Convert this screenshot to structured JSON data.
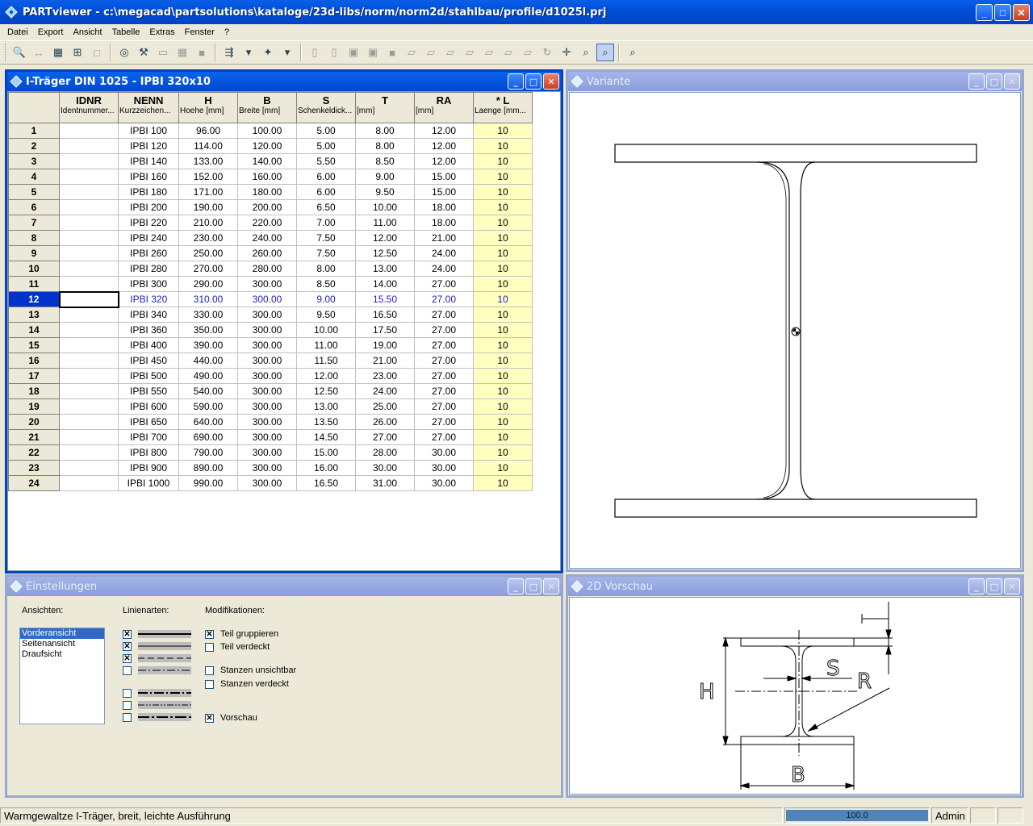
{
  "window": {
    "title": "PARTviewer - c:\\megacad\\partsolutions\\kataloge/23d-libs/norm/norm2d/stahlbau/profile/d1025l.prj",
    "minimize": "_",
    "maximize": "□",
    "close": "✕"
  },
  "menu": [
    "Datei",
    "Export",
    "Ansicht",
    "Tabelle",
    "Extras",
    "Fenster",
    "?"
  ],
  "table_window": {
    "title": "I-Träger DIN 1025 - IPBI 320x10",
    "columns": [
      {
        "name": "IDNR",
        "sub": "Identnummer..."
      },
      {
        "name": "NENN",
        "sub": "Kurzzeichen..."
      },
      {
        "name": "H",
        "sub": "Hoehe [mm]"
      },
      {
        "name": "B",
        "sub": "Breite [mm]"
      },
      {
        "name": "S",
        "sub": "Schenkeldick..."
      },
      {
        "name": "T",
        "sub": "[mm]"
      },
      {
        "name": "RA",
        "sub": "[mm]"
      },
      {
        "name": "* L",
        "sub": "Laenge [mm..."
      }
    ],
    "selected_row": 12,
    "rows": [
      [
        "1",
        "",
        "IPBI 100",
        "96.00",
        "100.00",
        "5.00",
        "8.00",
        "12.00",
        "10"
      ],
      [
        "2",
        "",
        "IPBI 120",
        "114.00",
        "120.00",
        "5.00",
        "8.00",
        "12.00",
        "10"
      ],
      [
        "3",
        "",
        "IPBI 140",
        "133.00",
        "140.00",
        "5.50",
        "8.50",
        "12.00",
        "10"
      ],
      [
        "4",
        "",
        "IPBI 160",
        "152.00",
        "160.00",
        "6.00",
        "9.00",
        "15.00",
        "10"
      ],
      [
        "5",
        "",
        "IPBI 180",
        "171.00",
        "180.00",
        "6.00",
        "9.50",
        "15.00",
        "10"
      ],
      [
        "6",
        "",
        "IPBI 200",
        "190.00",
        "200.00",
        "6.50",
        "10.00",
        "18.00",
        "10"
      ],
      [
        "7",
        "",
        "IPBI 220",
        "210.00",
        "220.00",
        "7.00",
        "11.00",
        "18.00",
        "10"
      ],
      [
        "8",
        "",
        "IPBI 240",
        "230.00",
        "240.00",
        "7.50",
        "12.00",
        "21.00",
        "10"
      ],
      [
        "9",
        "",
        "IPBI 260",
        "250.00",
        "260.00",
        "7.50",
        "12.50",
        "24.00",
        "10"
      ],
      [
        "10",
        "",
        "IPBI 280",
        "270.00",
        "280.00",
        "8.00",
        "13.00",
        "24.00",
        "10"
      ],
      [
        "11",
        "",
        "IPBI 300",
        "290.00",
        "300.00",
        "8.50",
        "14.00",
        "27.00",
        "10"
      ],
      [
        "12",
        "",
        "IPBI 320",
        "310.00",
        "300.00",
        "9.00",
        "15.50",
        "27.00",
        "10"
      ],
      [
        "13",
        "",
        "IPBI 340",
        "330.00",
        "300.00",
        "9.50",
        "16.50",
        "27.00",
        "10"
      ],
      [
        "14",
        "",
        "IPBI 360",
        "350.00",
        "300.00",
        "10.00",
        "17.50",
        "27.00",
        "10"
      ],
      [
        "15",
        "",
        "IPBI 400",
        "390.00",
        "300.00",
        "11.00",
        "19.00",
        "27.00",
        "10"
      ],
      [
        "16",
        "",
        "IPBI 450",
        "440.00",
        "300.00",
        "11.50",
        "21.00",
        "27.00",
        "10"
      ],
      [
        "17",
        "",
        "IPBI 500",
        "490.00",
        "300.00",
        "12.00",
        "23.00",
        "27.00",
        "10"
      ],
      [
        "18",
        "",
        "IPBI 550",
        "540.00",
        "300.00",
        "12.50",
        "24.00",
        "27.00",
        "10"
      ],
      [
        "19",
        "",
        "IPBI 600",
        "590.00",
        "300.00",
        "13.00",
        "25.00",
        "27.00",
        "10"
      ],
      [
        "20",
        "",
        "IPBI 650",
        "640.00",
        "300.00",
        "13.50",
        "26.00",
        "27.00",
        "10"
      ],
      [
        "21",
        "",
        "IPBI 700",
        "690.00",
        "300.00",
        "14.50",
        "27.00",
        "27.00",
        "10"
      ],
      [
        "22",
        "",
        "IPBI 800",
        "790.00",
        "300.00",
        "15.00",
        "28.00",
        "30.00",
        "10"
      ],
      [
        "23",
        "",
        "IPBI 900",
        "890.00",
        "300.00",
        "16.00",
        "30.00",
        "30.00",
        "10"
      ],
      [
        "24",
        "",
        "IPBI 1000",
        "990.00",
        "300.00",
        "16.50",
        "31.00",
        "30.00",
        "10"
      ]
    ]
  },
  "variant_window": {
    "title": "Variante"
  },
  "settings_window": {
    "title": "Einstellungen",
    "ansichten_label": "Ansichten:",
    "linienarten_label": "Linienarten:",
    "modifikationen_label": "Modifikationen:",
    "views": [
      "Vorderansicht",
      "Seitenansicht",
      "Draufsicht"
    ],
    "selected_view": "Vorderansicht",
    "linetypes_checked": [
      true,
      true,
      true,
      false,
      false,
      false,
      false
    ],
    "modifications": [
      {
        "label": "Teil gruppieren",
        "checked": true
      },
      {
        "label": "Teil verdeckt",
        "checked": false
      },
      {
        "label": "Stanzen unsichtbar",
        "checked": false
      },
      {
        "label": "Stanzen verdeckt",
        "checked": false
      },
      {
        "label": "Vorschau",
        "checked": true
      }
    ]
  },
  "preview_window": {
    "title": "2D Vorschau",
    "dim_labels": {
      "h": "H",
      "b": "B",
      "s": "S",
      "r": "R"
    }
  },
  "status": {
    "text": "Warmgewaltze I-Träger, breit, leichte Ausführung",
    "progress_value": "100.0",
    "progress_fraction": 1.0,
    "user": "Admin"
  }
}
